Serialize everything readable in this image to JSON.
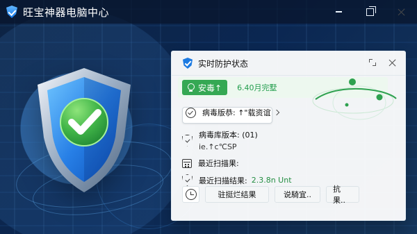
{
  "window": {
    "title": "旺宝神器电脑中心",
    "controls": {
      "minimize_icon": "minimize-icon",
      "restore_icon": "restore-icon",
      "close_icon": "close-icon"
    }
  },
  "panel": {
    "title": "实时防护状态",
    "status_label": "安毒↑",
    "completion_text": "6.40月完墅",
    "rows": [
      {
        "icon": "check-circle-icon",
        "label": "病毒版恭: ↑\"载资谊",
        "interactable": true
      },
      {
        "icon": "shield-outline-icon",
        "label": "病毒库版本: (01)",
        "subvalue": "ie.↑c℃SP"
      },
      {
        "icon": "calendar-icon",
        "label": "最近扫描果:"
      },
      {
        "icon": "shield-outline-icon",
        "label": "最近扫描结果:",
        "value": "2.3.8n Unt"
      }
    ],
    "footer_buttons": [
      {
        "label": "",
        "icon": "clock-icon"
      },
      {
        "label": "驻挺烂结果"
      },
      {
        "label": "说騎宜.."
      },
      {
        "label": "抗果.."
      }
    ]
  },
  "colors": {
    "background": "#0b2752",
    "panel": "#ffffff",
    "accent_blue": "#1d7be2",
    "success_green": "#35a853",
    "green_text": "#239d4d"
  }
}
